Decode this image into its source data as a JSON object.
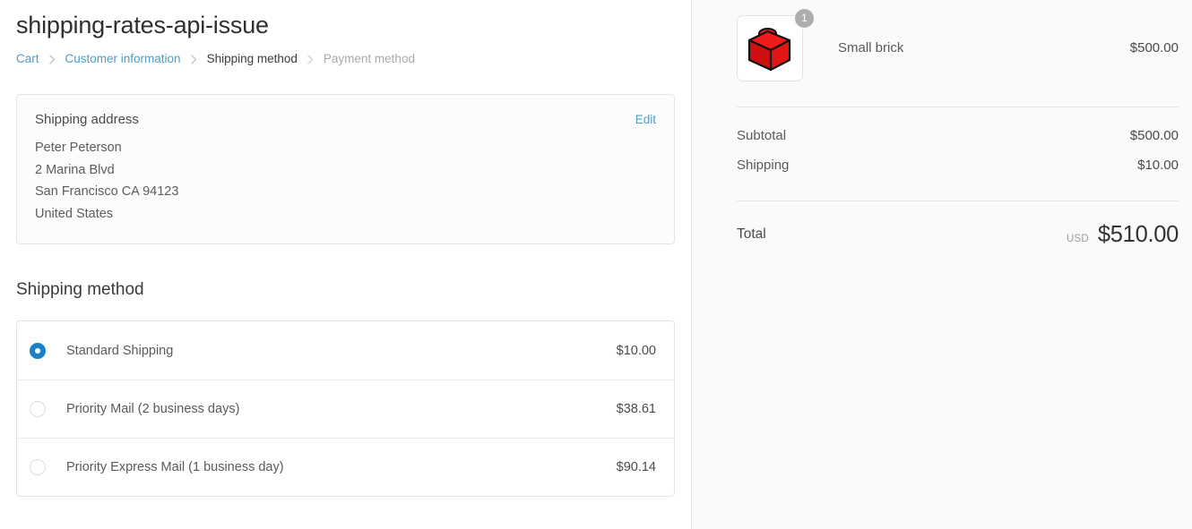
{
  "page": {
    "title": "shipping-rates-api-issue"
  },
  "breadcrumb": {
    "separator_icon": "chevron-right-icon",
    "items": [
      {
        "label": "Cart",
        "state": "link"
      },
      {
        "label": "Customer information",
        "state": "link"
      },
      {
        "label": "Shipping method",
        "state": "current"
      },
      {
        "label": "Payment method",
        "state": "future"
      }
    ]
  },
  "shipping_address": {
    "title": "Shipping address",
    "edit_label": "Edit",
    "lines": [
      "Peter Peterson",
      "2 Marina Blvd",
      "San Francisco CA 94123",
      "United States"
    ]
  },
  "shipping_method": {
    "section_title": "Shipping method",
    "options": [
      {
        "label": "Standard Shipping",
        "price": "$10.00",
        "selected": true
      },
      {
        "label": "Priority Mail (2 business days)",
        "price": "$38.61",
        "selected": false
      },
      {
        "label": "Priority Express Mail (1 business day)",
        "price": "$90.14",
        "selected": false
      }
    ]
  },
  "summary": {
    "product": {
      "name": "Small brick",
      "price": "$500.00",
      "quantity": "1",
      "thumbnail_icon": "red-brick-icon"
    },
    "lines": [
      {
        "label": "Subtotal",
        "value": "$500.00"
      },
      {
        "label": "Shipping",
        "value": "$10.00"
      }
    ],
    "total": {
      "label": "Total",
      "currency": "USD",
      "amount": "$510.00"
    }
  },
  "colors": {
    "link": "#4c9fc4",
    "radio_selected": "#1a81c4",
    "brick_red": "#e01b1b",
    "badge_grey": "#adadad",
    "panel_bg": "#fafafa"
  }
}
